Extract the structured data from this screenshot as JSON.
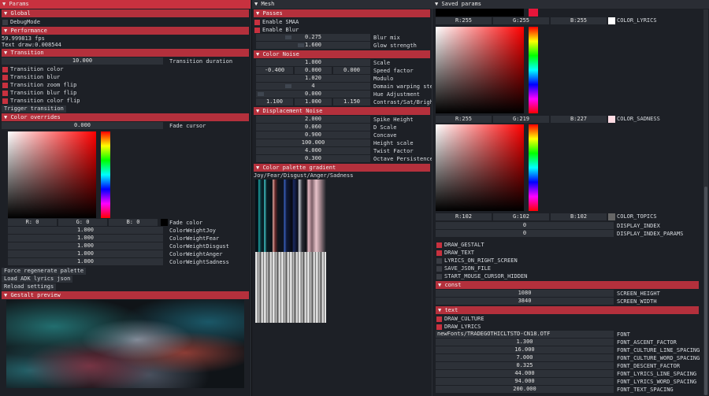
{
  "params": {
    "title": "Params",
    "global_header": "Global",
    "debug_mode": "DebugMode",
    "performance_header": "Performance",
    "fps": "59.999813 fps",
    "text_draw": "Text draw:0.008544",
    "transition_header": "Transition",
    "transition_duration_value": "10.000",
    "transition_duration_label": "Transition duration",
    "transition_checks": [
      "Transition color",
      "Transition blur",
      "Transition zoom flip",
      "Transition blur flip",
      "Transition color flip"
    ],
    "trigger_transition": "Trigger transition",
    "color_overrides_header": "Color overrides",
    "fade_cursor_value": "0.000",
    "fade_cursor_label": "Fade cursor",
    "rgb_r": "R:  0",
    "rgb_g": "G:  0",
    "rgb_b": "B:  0",
    "fade_color_label": "Fade color",
    "weights": [
      {
        "value": "1.000",
        "label": "ColorWeightJoy"
      },
      {
        "value": "1.000",
        "label": "ColorWeightFear"
      },
      {
        "value": "1.000",
        "label": "ColorWeightDisgust"
      },
      {
        "value": "1.000",
        "label": "ColorWeightAnger"
      },
      {
        "value": "1.000",
        "label": "ColorWeightSadness"
      }
    ],
    "force_regen": "Force regenerate palette",
    "load_adk": "Load ADK lyrics json",
    "reload_settings": "Reload settings",
    "gestalt_header": "Gestalt preview"
  },
  "mesh": {
    "title": "Mesh",
    "passes_header": "Passes",
    "enable_smaa": "Enable SMAA",
    "enable_blur": "Enable Blur",
    "blur_mix_value": "0.275",
    "blur_mix_label": "Blur mix",
    "glow_value": "1.600",
    "glow_label": "Glow strength",
    "color_noise_header": "Color Noise",
    "scale_value": "1.000",
    "scale_label": "Scale",
    "speed_values": [
      "-0.400",
      "0.000",
      "0.000"
    ],
    "speed_label": "Speed factor",
    "modulo_value": "1.020",
    "modulo_label": "Modulo",
    "domain_value": "4",
    "domain_label": "Domain warping step",
    "hue_value": "0.000",
    "hue_label": "Hue Adjustment",
    "csb_values": [
      "1.100",
      "1.000",
      "1.150"
    ],
    "csb_label": "Contrast/Sat/Brigh",
    "displacement_header": "Displacement Noise",
    "disp_rows": [
      {
        "value": "2.000",
        "label": "Spike Height"
      },
      {
        "value": "0.060",
        "label": "D Scale"
      },
      {
        "value": "0.900",
        "label": "Concave"
      },
      {
        "value": "100.000",
        "label": "Height scale"
      },
      {
        "value": "4.000",
        "label": "Twist Factor"
      },
      {
        "value": "0.300",
        "label": "Octave Persistence"
      }
    ],
    "gradient_header": "Color palette gradient",
    "gradient_caption": "Joy/Fear/Disgust/Anger/Sadness"
  },
  "saved": {
    "title": "Saved params",
    "lyrics_rgb": [
      "R:255",
      "G:255",
      "B:255"
    ],
    "lyrics_label": "COLOR_LYRICS",
    "sadness_rgb": [
      "R:255",
      "G:219",
      "B:227"
    ],
    "sadness_label": "COLOR_SADNESS",
    "topics_rgb": [
      "R:102",
      "G:102",
      "B:102"
    ],
    "topics_label": "COLOR_TOPICS",
    "display_index_value": "0",
    "display_index_label": "DISPLAY_INDEX",
    "display_index_params_value": "0",
    "display_index_params_label": "DISPLAY_INDEX_PARAMS",
    "checks": [
      {
        "label": "DRAW_GESTALT",
        "on": true
      },
      {
        "label": "DRAW_TEXT",
        "on": true
      },
      {
        "label": "LYRICS_ON_RIGHT_SCREEN",
        "on": false
      },
      {
        "label": "SAVE_JSON_FILE",
        "on": false
      },
      {
        "label": "START_MOUSE_CURSOR_HIDDEN",
        "on": false
      }
    ],
    "const_header": "const",
    "screen_height_value": "1080",
    "screen_height_label": "SCREEN_HEIGHT",
    "screen_width_value": "3840",
    "screen_width_label": "SCREEN_WIDTH",
    "text_header": "text",
    "draw_culture": "DRAW_CULTURE",
    "draw_lyrics": "DRAW_LYRICS",
    "font_value": "newFonts/TRADEGOTHICLTSTD-CN18.OTF",
    "font_label": "FONT",
    "font_rows": [
      {
        "value": "1.300",
        "label": "FONT_ASCENT_FACTOR"
      },
      {
        "value": "16.000",
        "label": "FONT_CULTURE_LINE_SPACING"
      },
      {
        "value": "7.000",
        "label": "FONT_CULTURE_WORD_SPACING"
      },
      {
        "value": "0.325",
        "label": "FONT_DESCENT_FACTOR"
      },
      {
        "value": "44.000",
        "label": "FONT_LYRICS_LINE_SPACING"
      },
      {
        "value": "94.000",
        "label": "FONT_LYRICS_WORD_SPACING"
      },
      {
        "value": "200.000",
        "label": "FONT_TEXT_SPACING"
      }
    ]
  },
  "colors": {
    "accent": "#c8313f",
    "panel": "#1d2026",
    "field": "#2d3138"
  }
}
